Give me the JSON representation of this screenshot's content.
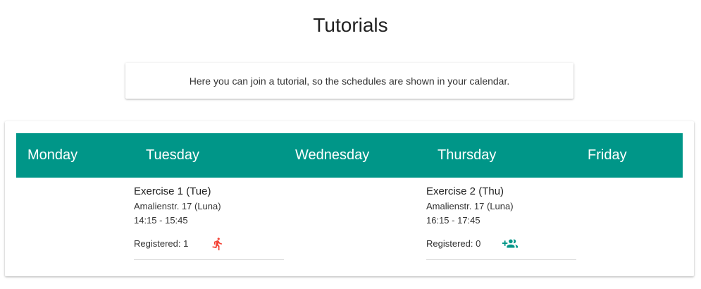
{
  "page": {
    "title": "Tutorials"
  },
  "info": {
    "text": "Here you can join a tutorial, so the schedules are shown in your calendar."
  },
  "colors": {
    "header_bg": "#009688",
    "leave_icon": "#f44336",
    "join_icon": "#009688"
  },
  "days": [
    "Monday",
    "Tuesday",
    "Wednesday",
    "Thursday",
    "Friday"
  ],
  "tutorials": [
    {
      "day": "Tuesday",
      "title": "Exercise 1 (Tue)",
      "room": "Amalienstr. 17 (Luna)",
      "time": "14:15 - 15:45",
      "registered": "Registered: 1",
      "action_icon": "run-icon"
    },
    {
      "day": "Thursday",
      "title": "Exercise 2 (Thu)",
      "room": "Amalienstr. 17 (Luna)",
      "time": "16:15 - 17:45",
      "registered": "Registered: 0",
      "action_icon": "group-add-icon"
    }
  ]
}
